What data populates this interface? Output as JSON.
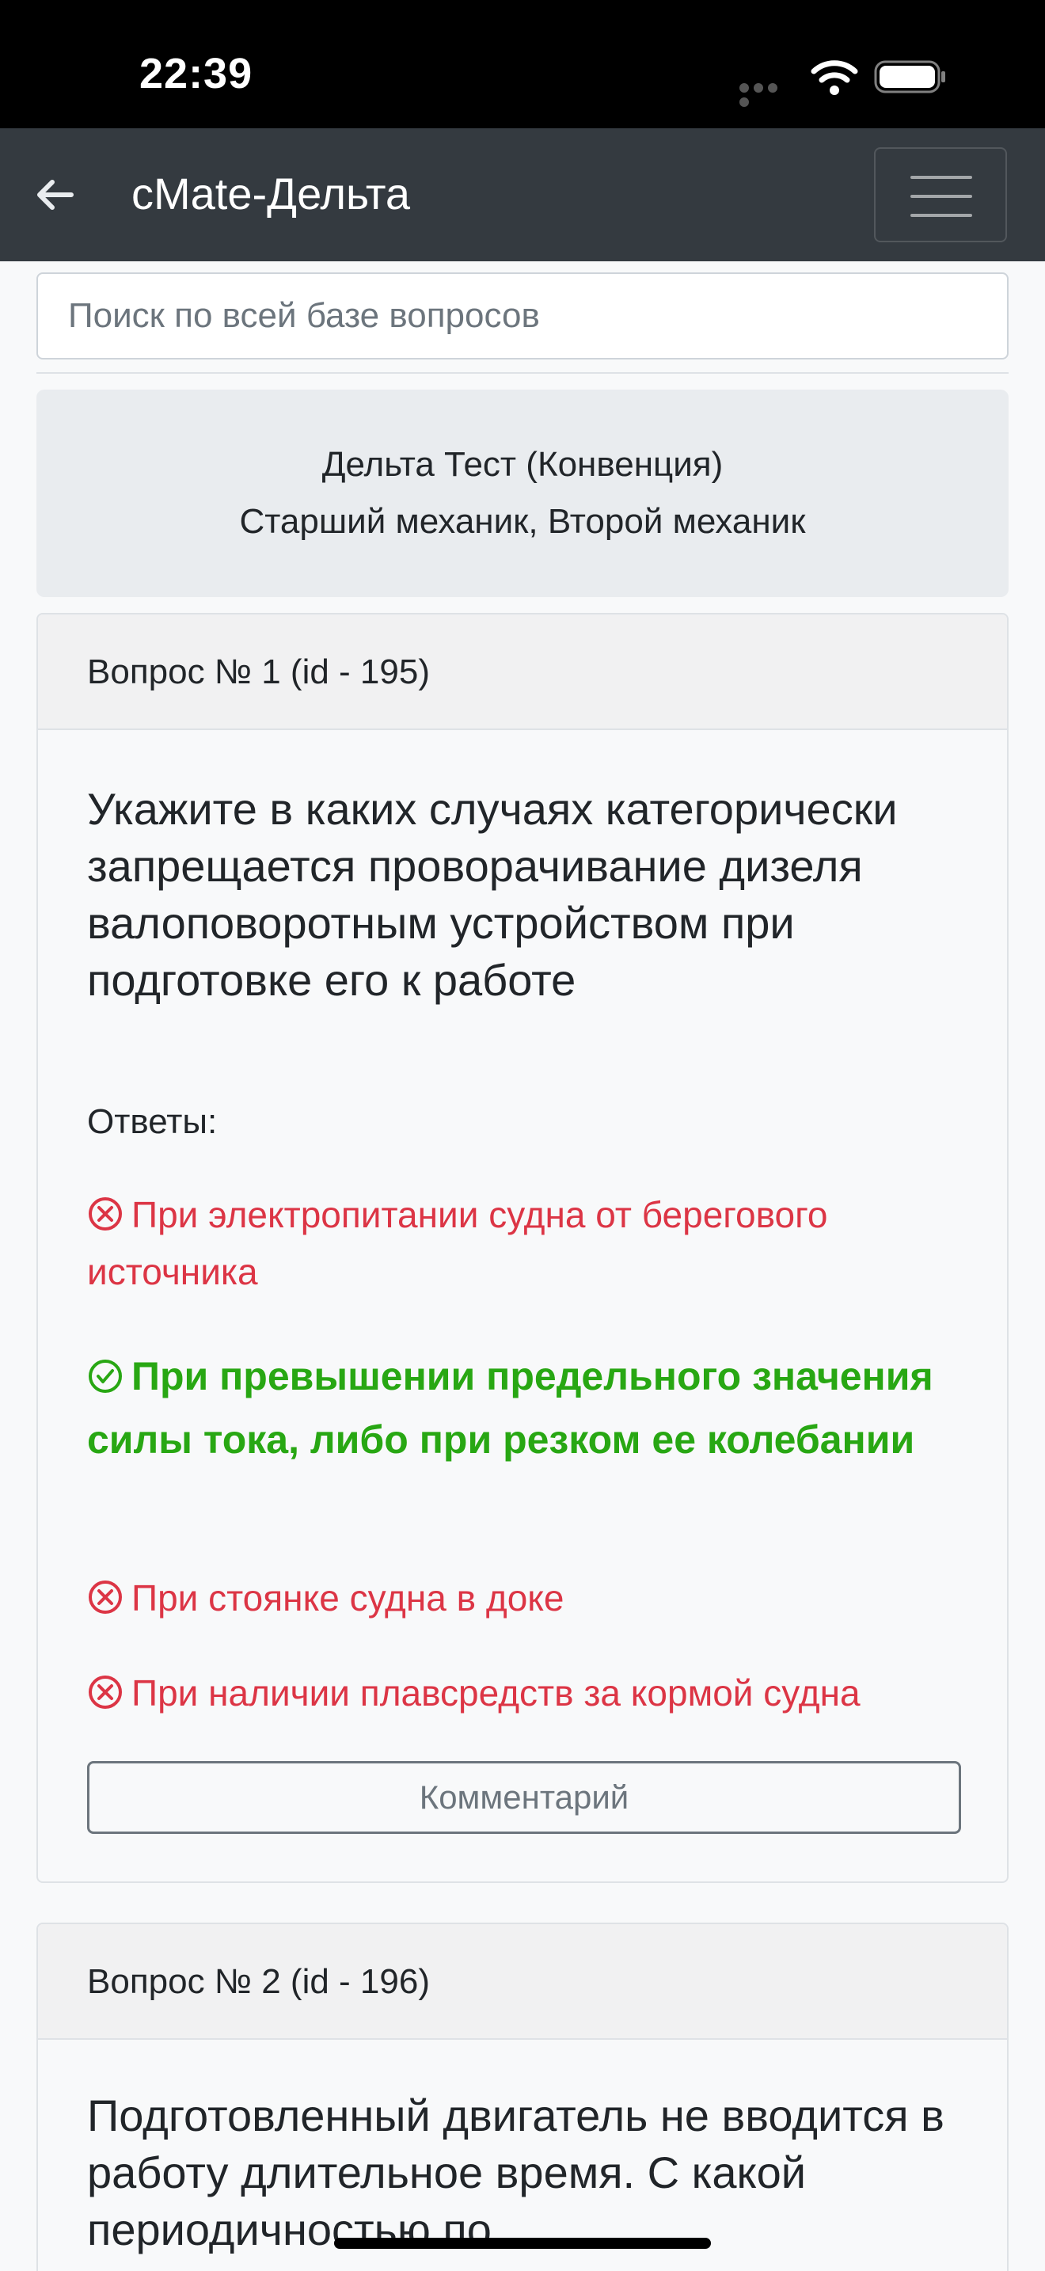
{
  "status_bar": {
    "time": "22:39"
  },
  "navbar": {
    "title": "cMate-Дельта",
    "back_icon": "arrow-left-icon",
    "menu_icon": "hamburger-icon"
  },
  "search": {
    "placeholder": "Поиск по всей базе вопросов",
    "value": ""
  },
  "test_info": {
    "line1": "Дельта Тест (Конвенция)",
    "line2": "Старший механик, Второй механик"
  },
  "questions": [
    {
      "header": "Вопрос № 1 (id - 195)",
      "text": "Укажите в каких случаях категорически запрещается проворачивание дизеля валоповоротным устройством при подготовке его к работе",
      "answers_label": "Ответы:",
      "answers": [
        {
          "text": "При электропитании судна от берегового источника",
          "correct": false
        },
        {
          "text": "При превышении предельного значения силы тока, либо при резком ее колебании",
          "correct": true
        },
        {
          "text": "При стоянке судна в доке",
          "correct": false
        },
        {
          "text": "При наличии плавсредств за кормой судна",
          "correct": false
        }
      ],
      "comment_label": "Комментарий"
    },
    {
      "header": "Вопрос № 2 (id - 196)",
      "text": "Подготовленный двигатель не вводится в работу длительное время. С какой периодичностью по"
    }
  ],
  "colors": {
    "wrong": "#dc3545",
    "correct": "#28a713",
    "navbar": "#343a40"
  }
}
